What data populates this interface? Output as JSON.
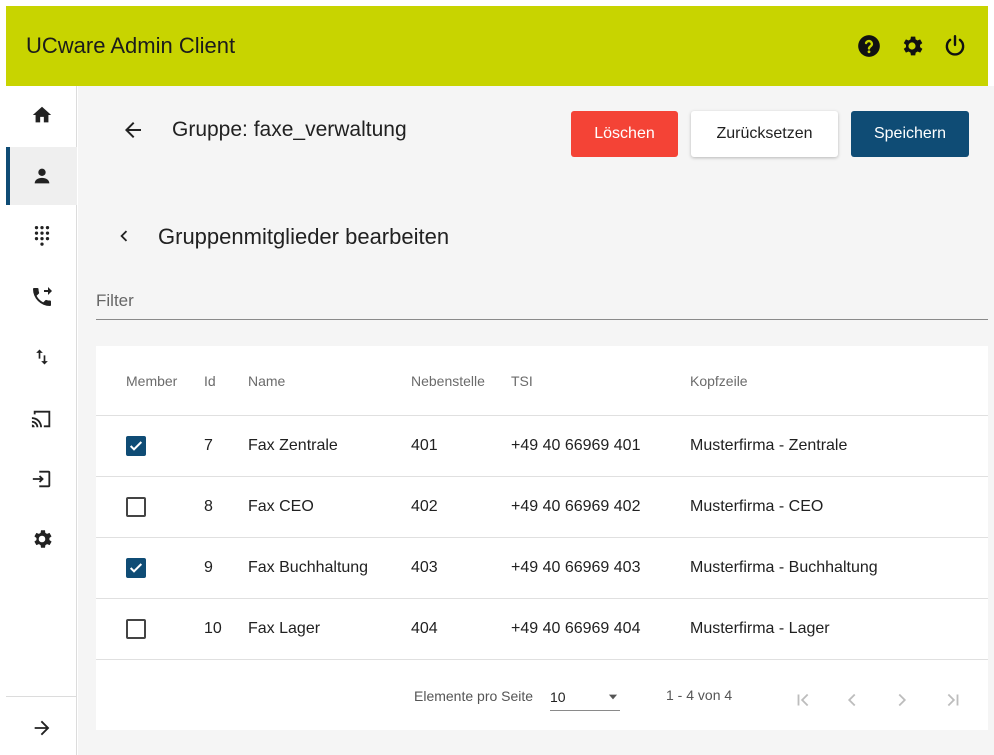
{
  "app": {
    "title": "UCware Admin Client"
  },
  "header_icons": [
    "help-icon",
    "settings-icon",
    "power-icon"
  ],
  "sidebar": {
    "items": [
      {
        "name": "home",
        "icon": "home-icon",
        "active": false
      },
      {
        "name": "users",
        "icon": "person-icon",
        "active": true
      },
      {
        "name": "dialpad",
        "icon": "dialpad-icon",
        "active": false
      },
      {
        "name": "call-forward",
        "icon": "phone-forward-icon",
        "active": false
      },
      {
        "name": "routing",
        "icon": "swap-vert-icon",
        "active": false
      },
      {
        "name": "cast",
        "icon": "cast-icon",
        "active": false
      },
      {
        "name": "login",
        "icon": "login-icon",
        "active": false
      },
      {
        "name": "settings",
        "icon": "gear-icon",
        "active": false
      }
    ],
    "expand_icon": "arrow-right-icon"
  },
  "page": {
    "title": "Gruppe: faxe_verwaltung",
    "buttons": {
      "delete": "Löschen",
      "reset": "Zurücksetzen",
      "save": "Speichern"
    },
    "section_title": "Gruppenmitglieder bearbeiten",
    "filter_placeholder": "Filter"
  },
  "table": {
    "columns": [
      "Member",
      "Id",
      "Name",
      "Nebenstelle",
      "TSI",
      "Kopfzeile"
    ],
    "rows": [
      {
        "member": true,
        "id": "7",
        "name": "Fax Zentrale",
        "ext": "401",
        "tsi": "+49 40 66969 401",
        "kopf": "Musterfirma - Zentrale"
      },
      {
        "member": false,
        "id": "8",
        "name": "Fax CEO",
        "ext": "402",
        "tsi": "+49 40 66969 402",
        "kopf": "Musterfirma - CEO"
      },
      {
        "member": true,
        "id": "9",
        "name": "Fax Buchhaltung",
        "ext": "403",
        "tsi": "+49 40 66969 403",
        "kopf": "Musterfirma - Buchhaltung"
      },
      {
        "member": false,
        "id": "10",
        "name": "Fax Lager",
        "ext": "404",
        "tsi": "+49 40 66969 404",
        "kopf": "Musterfirma - Lager"
      }
    ]
  },
  "pager": {
    "label": "Elemente pro Seite",
    "page_size": "10",
    "range": "1 - 4 von 4"
  },
  "colors": {
    "header": "#c8d400",
    "primary": "#0f4c75",
    "danger": "#f44336"
  }
}
